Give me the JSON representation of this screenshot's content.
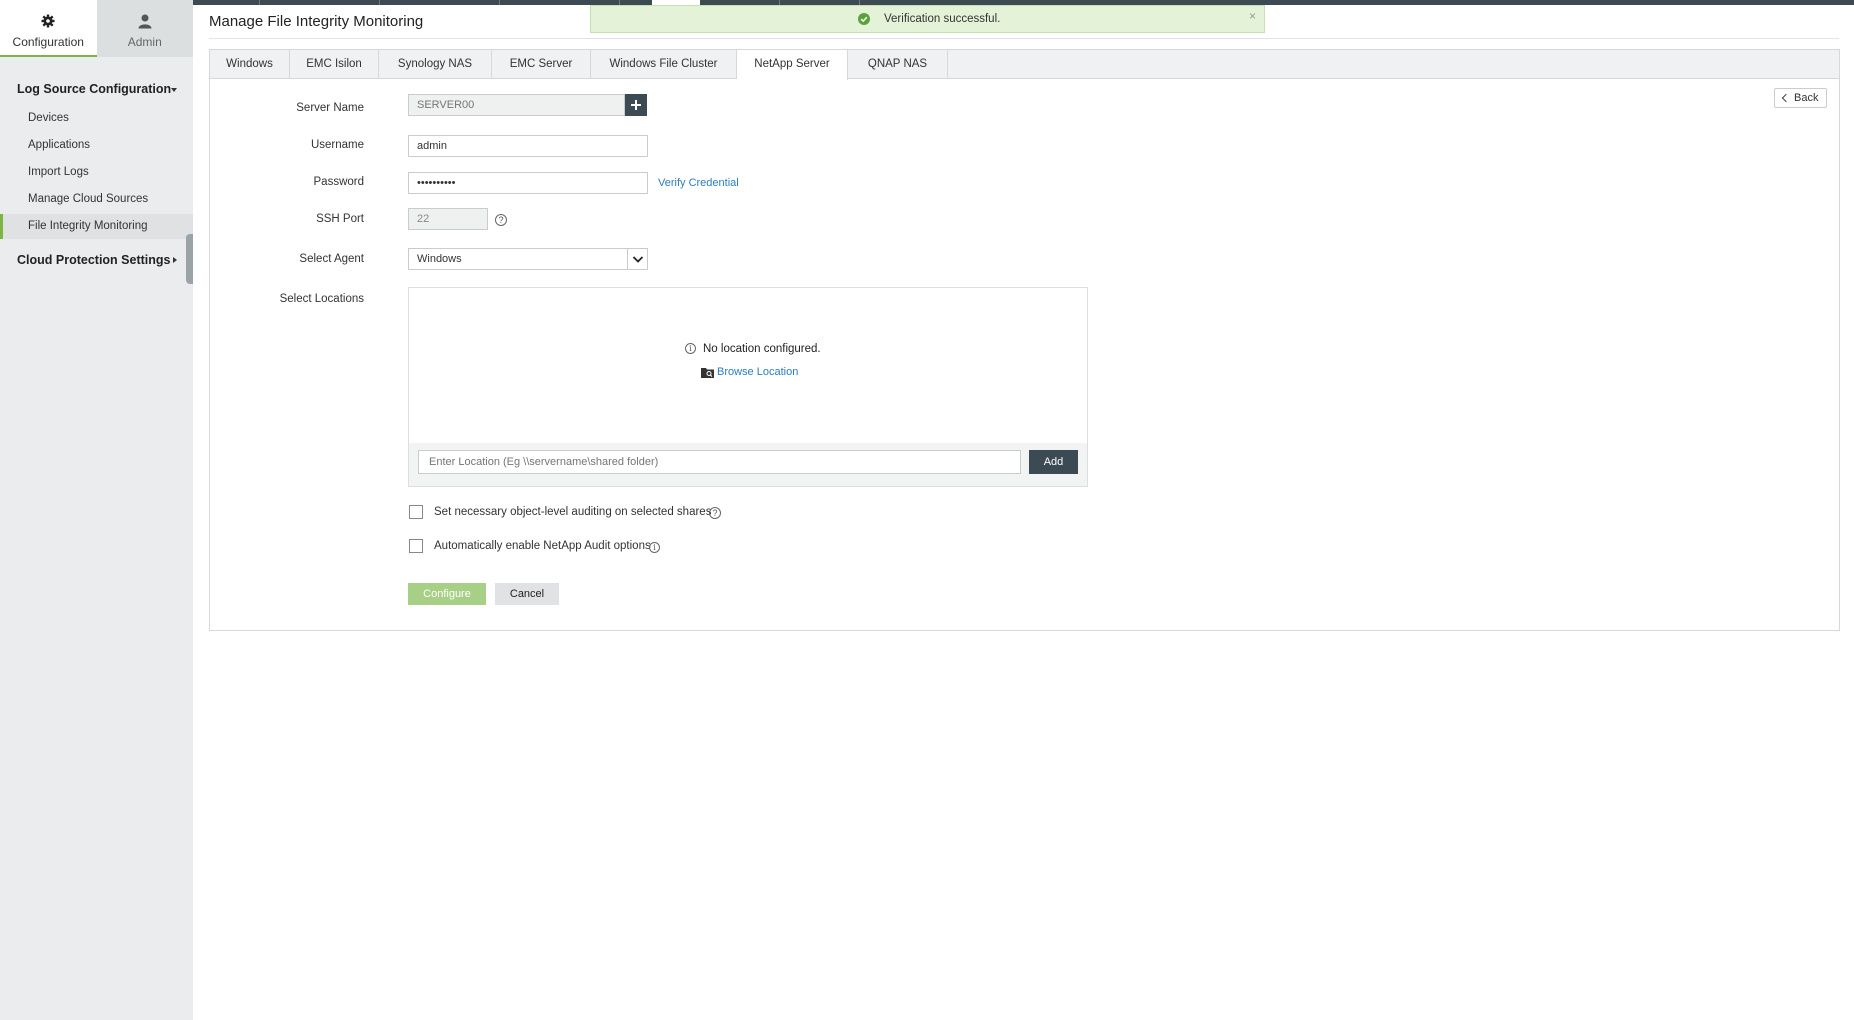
{
  "sidebar": {
    "tabs": [
      {
        "label": "Configuration",
        "icon": "gear-icon"
      },
      {
        "label": "Admin",
        "icon": "user-icon"
      }
    ],
    "sections": [
      {
        "label": "Log Source Configuration",
        "expanded": true,
        "items": [
          "Devices",
          "Applications",
          "Import Logs",
          "Manage Cloud Sources",
          "File Integrity Monitoring"
        ]
      },
      {
        "label": "Cloud Protection Settings",
        "expanded": false
      }
    ],
    "active_item": "File Integrity Monitoring"
  },
  "page": {
    "title": "Manage File Integrity Monitoring"
  },
  "toast": {
    "message": "Verification successful.",
    "close": "×",
    "status_color": "#5aa33c"
  },
  "tabs": [
    "Windows",
    "EMC Isilon",
    "Synology NAS",
    "EMC Server",
    "Windows File Cluster",
    "NetApp Server",
    "QNAP NAS"
  ],
  "active_tab": "NetApp Server",
  "back_label": "Back",
  "form": {
    "server_name": {
      "label": "Server Name",
      "placeholder": "SERVER00"
    },
    "username": {
      "label": "Username",
      "value": "admin"
    },
    "password": {
      "label": "Password",
      "value": "••••••••••",
      "verify_link": "Verify Credential"
    },
    "ssh_port": {
      "label": "SSH Port",
      "value": "22"
    },
    "agent": {
      "label": "Select Agent",
      "value": "Windows"
    },
    "locations": {
      "label": "Select Locations",
      "empty_text": "No location configured.",
      "browse_link": "Browse Location",
      "input_placeholder": "Enter Location (Eg \\\\servername\\shared folder)",
      "add_label": "Add"
    },
    "options": [
      {
        "label": "Set necessary object-level auditing on selected shares",
        "checked": false,
        "icon": "help-icon"
      },
      {
        "label": "Automatically enable NetApp Audit options",
        "checked": false,
        "icon": "info-icon"
      }
    ]
  },
  "actions": {
    "configure": "Configure",
    "cancel": "Cancel"
  },
  "colors": {
    "accent": "#7bb644",
    "dark": "#3c4a53",
    "link": "#2a7ec1",
    "configure_button": "#a7cf85"
  }
}
